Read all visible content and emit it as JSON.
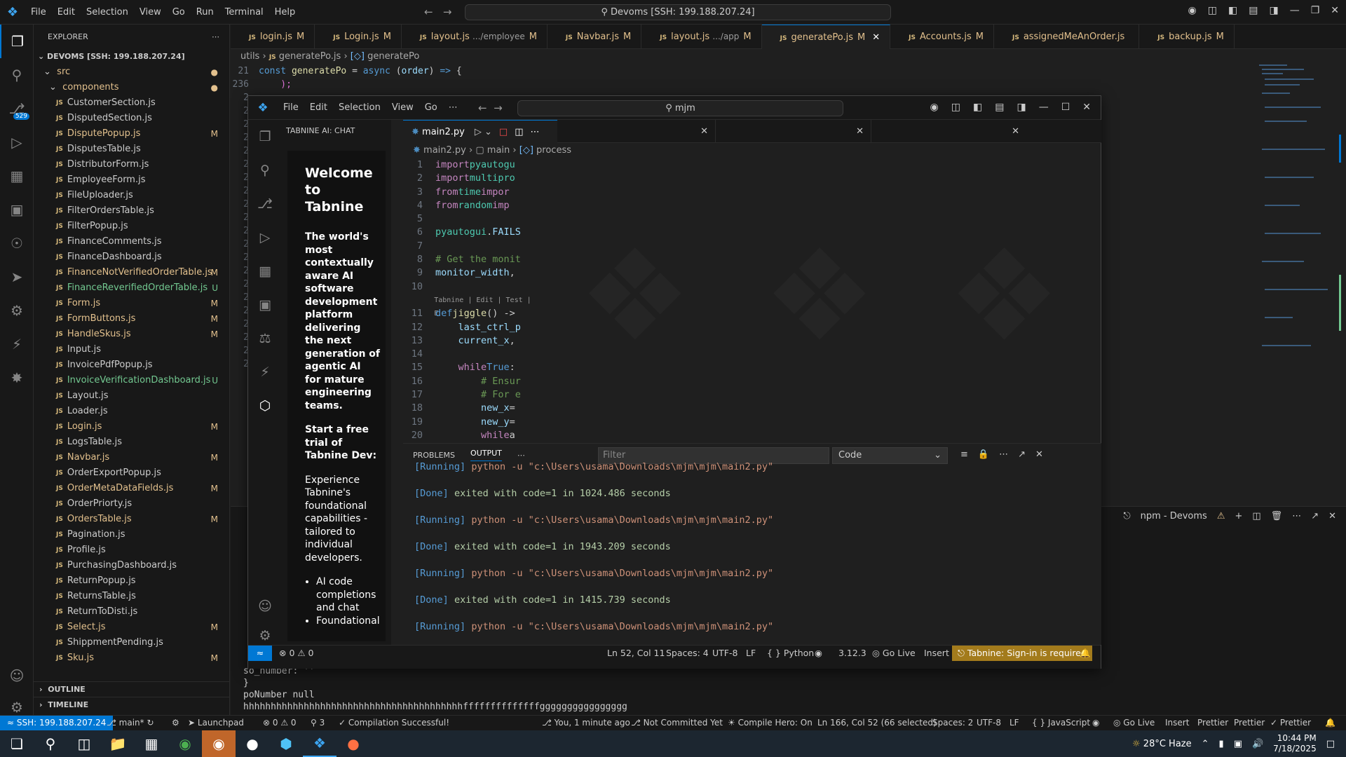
{
  "outer": {
    "menu": [
      "File",
      "Edit",
      "Selection",
      "View",
      "Go",
      "Run",
      "Terminal",
      "Help"
    ],
    "command_center": "Devoms [SSH: 199.188.207.24]",
    "explorer_title": "EXPLORER",
    "workspace": "DEVOMS [SSH: 199.188.207.24]",
    "folders": [
      "src",
      "components"
    ],
    "files": [
      {
        "name": "CustomerSection.js",
        "status": ""
      },
      {
        "name": "DisputedSection.js",
        "status": ""
      },
      {
        "name": "DisputePopup.js",
        "status": "M"
      },
      {
        "name": "DisputesTable.js",
        "status": ""
      },
      {
        "name": "DistributorForm.js",
        "status": ""
      },
      {
        "name": "EmployeeForm.js",
        "status": ""
      },
      {
        "name": "FileUploader.js",
        "status": ""
      },
      {
        "name": "FilterOrdersTable.js",
        "status": ""
      },
      {
        "name": "FilterPopup.js",
        "status": ""
      },
      {
        "name": "FinanceComments.js",
        "status": ""
      },
      {
        "name": "FinanceDashboard.js",
        "status": ""
      },
      {
        "name": "FinanceNotVerifiedOrderTable.js",
        "status": "M"
      },
      {
        "name": "FinanceReverifiedOrderTable.js",
        "status": "U"
      },
      {
        "name": "Form.js",
        "status": "M"
      },
      {
        "name": "FormButtons.js",
        "status": "M"
      },
      {
        "name": "HandleSkus.js",
        "status": "M"
      },
      {
        "name": "Input.js",
        "status": ""
      },
      {
        "name": "InvoicePdfPopup.js",
        "status": ""
      },
      {
        "name": "InvoiceVerificationDashboard.js",
        "status": "U"
      },
      {
        "name": "Layout.js",
        "status": ""
      },
      {
        "name": "Loader.js",
        "status": ""
      },
      {
        "name": "Login.js",
        "status": "M"
      },
      {
        "name": "LogsTable.js",
        "status": ""
      },
      {
        "name": "Navbar.js",
        "status": "M"
      },
      {
        "name": "OrderExportPopup.js",
        "status": ""
      },
      {
        "name": "OrderMetaDataFields.js",
        "status": "M"
      },
      {
        "name": "OrderPriorty.js",
        "status": ""
      },
      {
        "name": "OrdersTable.js",
        "status": "M"
      },
      {
        "name": "Pagination.js",
        "status": ""
      },
      {
        "name": "Profile.js",
        "status": ""
      },
      {
        "name": "PurchasingDashboard.js",
        "status": ""
      },
      {
        "name": "ReturnPopup.js",
        "status": ""
      },
      {
        "name": "ReturnsTable.js",
        "status": ""
      },
      {
        "name": "ReturnToDisti.js",
        "status": ""
      },
      {
        "name": "Select.js",
        "status": "M"
      },
      {
        "name": "ShippmentPending.js",
        "status": ""
      },
      {
        "name": "Sku.js",
        "status": "M"
      }
    ],
    "outline": "OUTLINE",
    "timeline": "TIMELINE",
    "tabs": [
      {
        "name": "login.js",
        "sub": "",
        "status": "M",
        "active": false
      },
      {
        "name": "Login.js",
        "sub": "",
        "status": "M",
        "active": false
      },
      {
        "name": "layout.js",
        "sub": ".../employee",
        "status": "M",
        "active": false
      },
      {
        "name": "Navbar.js",
        "sub": "",
        "status": "M",
        "active": false
      },
      {
        "name": "layout.js",
        "sub": ".../app",
        "status": "M",
        "active": false
      },
      {
        "name": "generatePo.js",
        "sub": "",
        "status": "M",
        "active": true
      },
      {
        "name": "Accounts.js",
        "sub": "",
        "status": "M",
        "active": false
      },
      {
        "name": "assignedMeAnOrder.js",
        "sub": "",
        "status": "",
        "active": false
      },
      {
        "name": "backup.js",
        "sub": "",
        "status": "M",
        "active": false
      }
    ],
    "breadcrumb": [
      "utils",
      "generatePo.js",
      "generatePo"
    ],
    "code_line_21": "const generatePo = async (order) => {",
    "code_line_236": "  );",
    "terminal_title": "npm - Devoms",
    "terminal_lines": [
      "so_number: ''",
      "}",
      "poNumber null",
      "hhhhhhhhhhhhhhhhhhhhhhhhhhhhhhhhhhhhhhhhffffffffffffffgggggggggggggggg"
    ],
    "status": {
      "remote": "SSH: 199.188.207.24",
      "branch": "main*",
      "launchpad": "Launchpad",
      "problems": "0 ⚠ 0",
      "ports": "3",
      "compile": "Compilation Successful!",
      "blame": "You, 1 minute ago",
      "committed": "Not Committed Yet",
      "hero": "Compile Hero: On",
      "cursor": "Ln 166, Col 52 (66 selected)",
      "spaces": "Spaces: 2",
      "encoding": "UTF-8",
      "eol": "LF",
      "lang": "JavaScript",
      "golive": "Go Live",
      "insert": "Insert",
      "prettier1": "Prettier",
      "prettier2": "Prettier",
      "prettier3": "Prettier"
    },
    "source_control_badge": "529"
  },
  "inner": {
    "menu": [
      "File",
      "Edit",
      "Selection",
      "View",
      "Go"
    ],
    "command_center": "mjm",
    "chat_title": "TABNINE AI: CHAT",
    "welcome": "Welcome to Tabnine",
    "tagline": "The world's most contextually aware AI software development platform delivering the next generation of agentic AI for mature engineering teams.",
    "trial": "Start a free trial of Tabnine Dev:",
    "trial_desc": "Experience Tabnine's foundational capabilities - tailored to individual developers.",
    "bullets": [
      "AI code completions and chat",
      "Foundational"
    ],
    "tab": "main2.py",
    "breadcrumb": [
      "main2.py",
      "main",
      "process"
    ],
    "codelens": "Tabnine | Edit | Test | E",
    "panel_tabs": [
      "PROBLEMS",
      "OUTPUT"
    ],
    "filter_placeholder": "Filter",
    "output_channel": "Code",
    "output": [
      {
        "kind": "Running",
        "text": "python -u \"c:\\Users\\usama\\Downloads\\mjm\\mjm\\main2.py\""
      },
      {
        "kind": "Done",
        "text": "exited with code=1 in 1024.486 seconds"
      },
      {
        "kind": "Running",
        "text": "python -u \"c:\\Users\\usama\\Downloads\\mjm\\mjm\\main2.py\""
      },
      {
        "kind": "Done",
        "text": "exited with code=1 in 1943.209 seconds"
      },
      {
        "kind": "Running",
        "text": "python -u \"c:\\Users\\usama\\Downloads\\mjm\\mjm\\main2.py\""
      },
      {
        "kind": "Done",
        "text": "exited with code=1 in 1415.739 seconds"
      },
      {
        "kind": "Running",
        "text": "python -u \"c:\\Users\\usama\\Downloads\\mjm\\mjm\\main2.py\""
      }
    ],
    "status": {
      "errors": "0 ⚠ 0",
      "cursor": "Ln 52, Col 11",
      "spaces": "Spaces: 4",
      "encoding": "UTF-8",
      "eol": "LF",
      "lang": "Python",
      "version": "3.12.3",
      "golive": "Go Live",
      "insert": "Insert",
      "tabnine": "Tabnine: Sign-in is required"
    }
  },
  "taskbar": {
    "weather": "28°C  Haze",
    "time": "10:44 PM",
    "date": "7/18/2025"
  },
  "colors": {
    "accent": "#0078d4",
    "modified": "#e2c08d",
    "untracked": "#73c991",
    "tabnine_status": "#a37b1c"
  }
}
